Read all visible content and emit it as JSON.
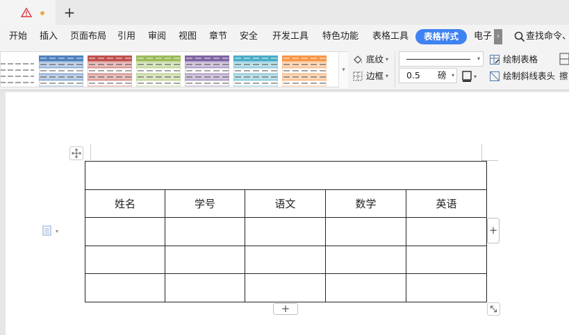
{
  "tab": {
    "warning_icon": "warning-triangle-icon",
    "modified_indicator": "dot-icon",
    "new_tab_label": "+"
  },
  "menu": {
    "items": [
      "开始",
      "插入",
      "页面布局",
      "引用",
      "审阅",
      "视图",
      "章节",
      "安全",
      "开发工具",
      "特色功能",
      "表格工具"
    ],
    "active": "表格样式",
    "overflow": "电子",
    "overflow_arrow": "›",
    "search_label": "查找命令、"
  },
  "ribbon": {
    "style_colors": [
      "#4f80bd",
      "#c0504d",
      "#9bbb59",
      "#8064a2",
      "#4bacc6",
      "#f79646"
    ],
    "shading_label": "底纹",
    "border_label": "边框",
    "line_width_value": "0.5",
    "line_width_unit": "磅",
    "draw_table_label": "绘制表格",
    "draw_diagonal_label": "绘制斜线表头",
    "erase_label": "擦"
  },
  "table": {
    "headers": [
      "姓名",
      "学号",
      "语文",
      "数学",
      "英语"
    ],
    "add_column_label": "+",
    "add_row_label": "+"
  }
}
